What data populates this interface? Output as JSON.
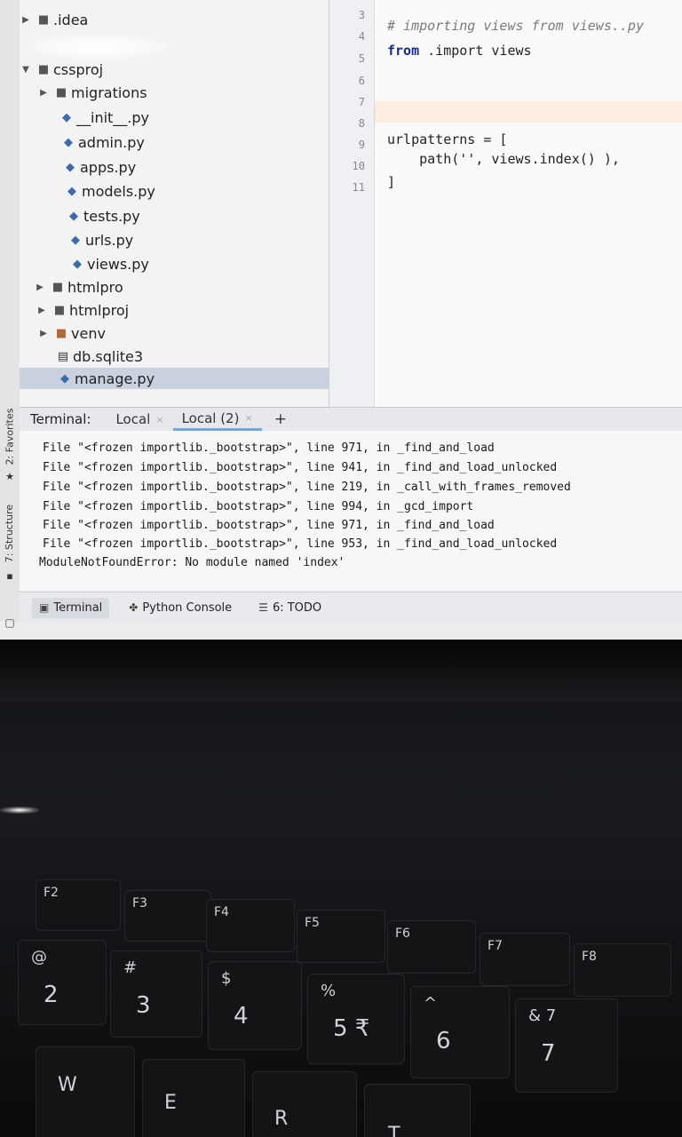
{
  "sidebar": {
    "favorites_tab": "2: Favorites",
    "structure_tab": "7: Structure"
  },
  "project_tree": {
    "items": [
      {
        "label": ".idea",
        "kind": "dir",
        "expanded": false
      },
      {
        "label": "cssproj",
        "kind": "dir",
        "expanded": true
      },
      {
        "label": "migrations",
        "kind": "dir",
        "expanded": false
      },
      {
        "label": "__init__.py",
        "kind": "py"
      },
      {
        "label": "admin.py",
        "kind": "py"
      },
      {
        "label": "apps.py",
        "kind": "py"
      },
      {
        "label": "models.py",
        "kind": "py"
      },
      {
        "label": "tests.py",
        "kind": "py"
      },
      {
        "label": "urls.py",
        "kind": "py"
      },
      {
        "label": "views.py",
        "kind": "py"
      },
      {
        "label": "htmlpro",
        "kind": "dir",
        "expanded": false
      },
      {
        "label": "htmlproj",
        "kind": "dir",
        "expanded": false
      },
      {
        "label": "venv",
        "kind": "venv",
        "expanded": false
      },
      {
        "label": "db.sqlite3",
        "kind": "db"
      },
      {
        "label": "manage.py",
        "kind": "py",
        "selected": true
      }
    ]
  },
  "editor": {
    "line_numbers": [
      "3",
      "4",
      "5",
      "6",
      "7",
      "8",
      "9",
      "10",
      "11"
    ],
    "lines": {
      "l4_comment": "# importing views from views..py",
      "l5_from": "from",
      "l5_rest": " .import views",
      "l9": "urlpatterns = [",
      "l10": "    path('', views.index() ),",
      "l11": "]"
    },
    "highlight_color": "#fbeee0"
  },
  "terminal": {
    "label": "Terminal:",
    "tabs": [
      {
        "label": "Local",
        "active": false
      },
      {
        "label": "Local (2)",
        "active": true
      }
    ],
    "add_label": "+",
    "output": [
      "File \"<frozen importlib._bootstrap>\", line 971, in _find_and_load",
      "File \"<frozen importlib._bootstrap>\", line 941, in _find_and_load_unlocked",
      "File \"<frozen importlib._bootstrap>\", line 219, in _call_with_frames_removed",
      "File \"<frozen importlib._bootstrap>\", line 994, in _gcd_import",
      "File \"<frozen importlib._bootstrap>\", line 971, in _find_and_load",
      "File \"<frozen importlib._bootstrap>\", line 953, in _find_and_load_unlocked"
    ],
    "error": "ModuleNotFoundError: No module named 'index'"
  },
  "bottom_bar": {
    "tabs": [
      {
        "label": "Terminal",
        "icon": "terminal-icon",
        "active": true
      },
      {
        "label": "Python Console",
        "icon": "python-icon",
        "active": false
      },
      {
        "label": "6: TODO",
        "icon": "todo-icon",
        "active": false
      }
    ]
  },
  "keyboard": {
    "fkeys": [
      "F2",
      "F3",
      "F4",
      "F5",
      "F6",
      "F7",
      "F8"
    ],
    "number_row": [
      {
        "top": "@",
        "bottom": "2"
      },
      {
        "top": "#",
        "bottom": "3"
      },
      {
        "top": "$",
        "bottom": "4"
      },
      {
        "top": "%",
        "bottom": "5 ₹"
      },
      {
        "top": "^",
        "bottom": "6"
      },
      {
        "top": "& 7",
        "bottom": "7"
      }
    ],
    "letter_row": [
      "W",
      "E",
      "R",
      "T"
    ]
  }
}
